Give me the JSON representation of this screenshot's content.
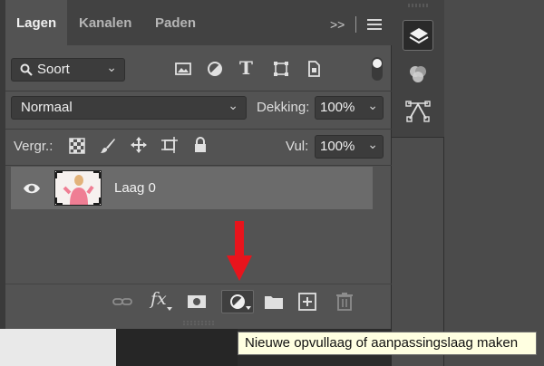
{
  "tabs": [
    {
      "label": "Lagen",
      "active": true
    },
    {
      "label": "Kanalen",
      "active": false
    },
    {
      "label": "Paden",
      "active": false
    }
  ],
  "overflow_label": ">>",
  "filter": {
    "label": "Soort",
    "icons": [
      "image-filter-icon",
      "adjustment-filter-icon",
      "type-filter-icon",
      "shape-filter-icon",
      "smart-object-filter-icon",
      "filter-toggle-icon"
    ]
  },
  "blend": {
    "mode": "Normaal",
    "opacity_label": "Dekking:",
    "opacity_value": "100%"
  },
  "lock": {
    "label": "Vergr.:",
    "fill_label": "Vul:",
    "fill_value": "100%",
    "icons": [
      "lock-transparent-pixels-icon",
      "lock-image-pixels-icon",
      "lock-position-icon",
      "lock-artboard-icon",
      "lock-all-icon"
    ]
  },
  "layers": [
    {
      "name": "Laag 0",
      "visible": true
    }
  ],
  "bottom_icons": [
    "link-layers-icon",
    "fx-icon",
    "layer-mask-icon",
    "new-adjustment-layer-icon",
    "new-group-icon",
    "new-layer-icon",
    "delete-layer-icon"
  ],
  "tooltip": "Nieuwe opvullaag of aanpassingslaag maken",
  "colors": {
    "panel": "#535353",
    "tabbar": "#424242",
    "selected_layer": "#6b6b6b",
    "arrow": "#e8141c",
    "tooltip_bg": "#ffffe1"
  }
}
